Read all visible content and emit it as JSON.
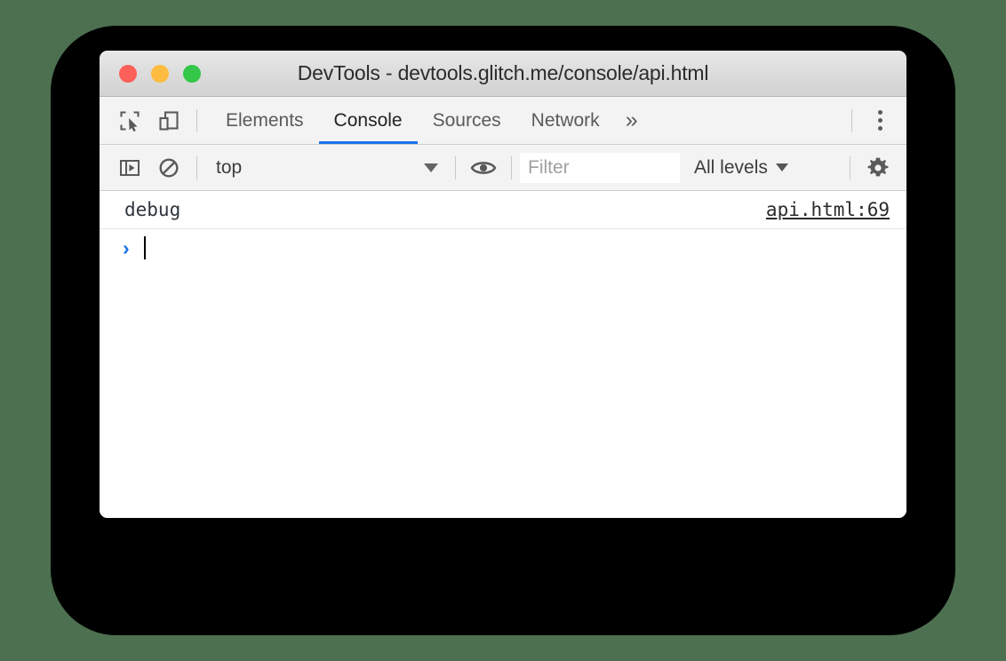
{
  "window": {
    "title": "DevTools - devtools.glitch.me/console/api.html",
    "traffic_lights": {
      "close_label": "close",
      "minimize_label": "minimize",
      "zoom_label": "zoom",
      "close_color": "#fc6058",
      "minimize_color": "#fdbc40",
      "zoom_color": "#34c749"
    }
  },
  "tabbar": {
    "inspect_icon": "inspect-element-icon",
    "device_icon": "device-toolbar-icon",
    "tabs": [
      {
        "label": "Elements",
        "active": false
      },
      {
        "label": "Console",
        "active": true
      },
      {
        "label": "Sources",
        "active": false
      },
      {
        "label": "Network",
        "active": false
      }
    ],
    "overflow_label": "»",
    "menu_icon": "more-vertical-icon",
    "active_underline_color": "#1a73e8"
  },
  "toolbar": {
    "sidebar_icon": "console-sidebar-icon",
    "clear_icon": "clear-console-icon",
    "context": {
      "value": "top",
      "chevron_icon": "chevron-down-icon"
    },
    "eye_icon": "eye-icon",
    "filter": {
      "value": "",
      "placeholder": "Filter"
    },
    "levels": {
      "label": "All levels",
      "chevron_icon": "chevron-down-icon"
    },
    "settings_icon": "gear-icon"
  },
  "console": {
    "messages": [
      {
        "text": "debug",
        "source": "api.html:69",
        "level": "debug"
      }
    ],
    "prompt": {
      "chevron": "›",
      "value": ""
    }
  },
  "colors": {
    "page_background": "#4d7050",
    "backdrop": "#000000",
    "accent": "#1a73e8",
    "toolbar_background": "#f3f3f3",
    "console_background": "#ffffff"
  }
}
